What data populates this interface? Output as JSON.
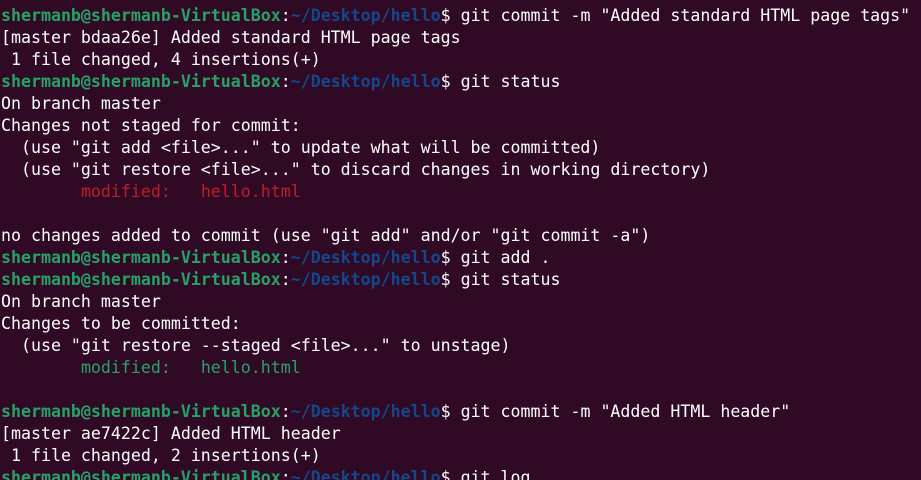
{
  "colors": {
    "background": "#300a24",
    "foreground": "#ffffff",
    "prompt_user": "#26a269",
    "prompt_path": "#12488b",
    "unstaged": "#c01c28",
    "staged": "#26a269"
  },
  "prompt": {
    "user_host": "shermanb@shermanb-VirtualBox",
    "colon": ":",
    "path": "~/Desktop/hello",
    "dollar": "$ "
  },
  "lines": [
    {
      "type": "prompt",
      "command": "git commit -m \"Added standard HTML page tags\""
    },
    {
      "type": "output",
      "text": "[master bdaa26e] Added standard HTML page tags"
    },
    {
      "type": "output",
      "text": " 1 file changed, 4 insertions(+)"
    },
    {
      "type": "prompt",
      "command": "git status"
    },
    {
      "type": "output",
      "text": "On branch master"
    },
    {
      "type": "output",
      "text": "Changes not staged for commit:"
    },
    {
      "type": "output",
      "text": "  (use \"git add <file>...\" to update what will be committed)"
    },
    {
      "type": "output",
      "text": "  (use \"git restore <file>...\" to discard changes in working directory)"
    },
    {
      "type": "output",
      "text": "\tmodified:   hello.html",
      "color": "red"
    },
    {
      "type": "output",
      "text": ""
    },
    {
      "type": "output",
      "text": "no changes added to commit (use \"git add\" and/or \"git commit -a\")"
    },
    {
      "type": "prompt",
      "command": "git add ."
    },
    {
      "type": "prompt",
      "command": "git status"
    },
    {
      "type": "output",
      "text": "On branch master"
    },
    {
      "type": "output",
      "text": "Changes to be committed:"
    },
    {
      "type": "output",
      "text": "  (use \"git restore --staged <file>...\" to unstage)"
    },
    {
      "type": "output",
      "text": "\tmodified:   hello.html",
      "color": "green"
    },
    {
      "type": "output",
      "text": ""
    },
    {
      "type": "prompt",
      "command": "git commit -m \"Added HTML header\""
    },
    {
      "type": "output",
      "text": "[master ae7422c] Added HTML header"
    },
    {
      "type": "output",
      "text": " 1 file changed, 2 insertions(+)"
    },
    {
      "type": "prompt",
      "command": "git log"
    }
  ]
}
